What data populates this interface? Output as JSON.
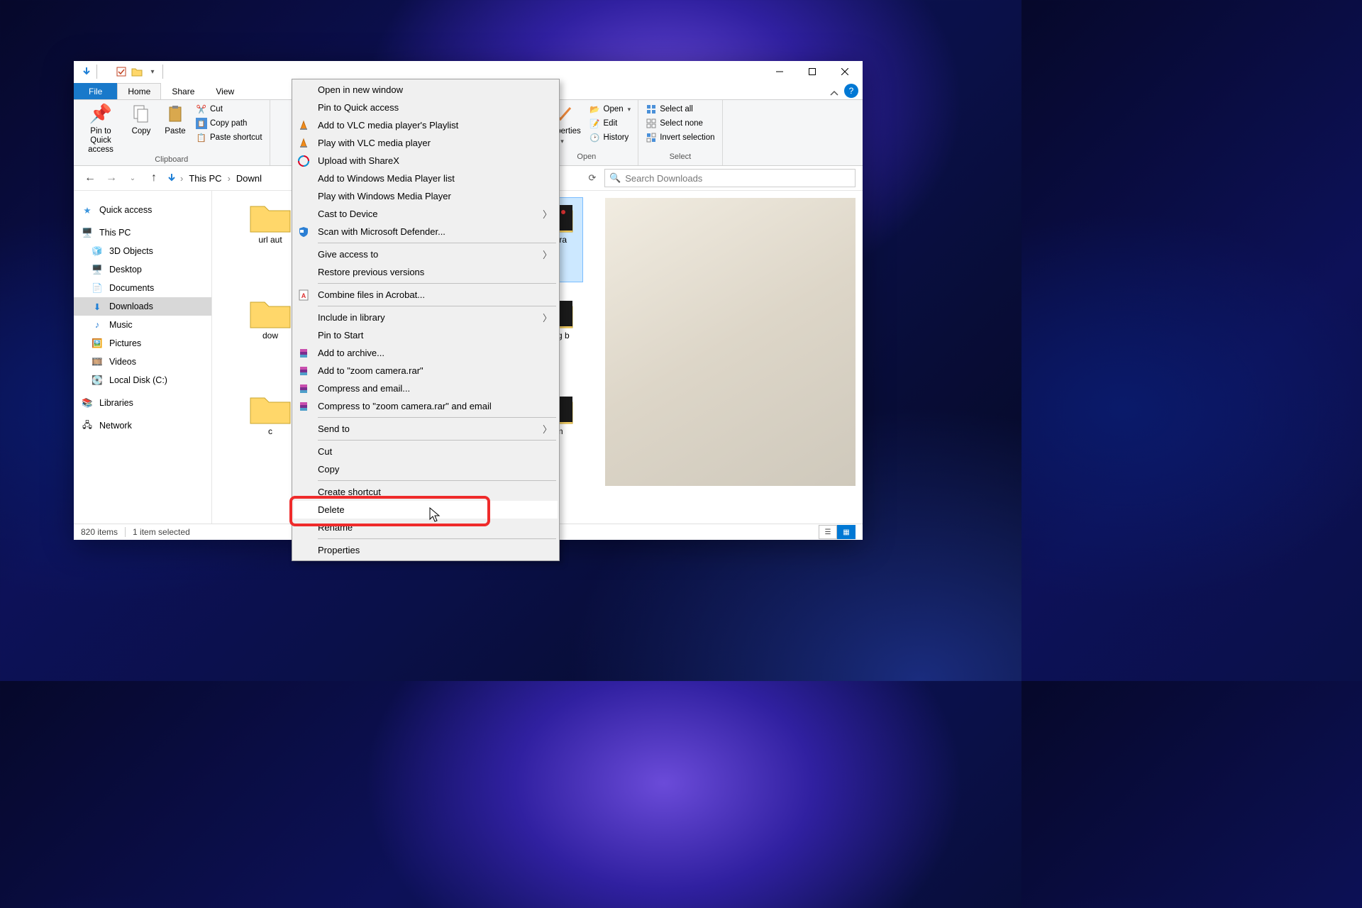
{
  "tabs": {
    "file": "File",
    "home": "Home",
    "share": "Share",
    "view": "View"
  },
  "ribbon": {
    "clipboard": {
      "pin": "Pin to Quick access",
      "copy": "Copy",
      "paste": "Paste",
      "cut": "Cut",
      "copypath": "Copy path",
      "pasteshort": "Paste shortcut",
      "label": "Clipboard"
    },
    "open": {
      "properties": "Properties",
      "open": "Open",
      "edit": "Edit",
      "history": "History",
      "label": "Open"
    },
    "select": {
      "all": "Select all",
      "none": "Select none",
      "invert": "Invert selection",
      "label": "Select"
    }
  },
  "breadcrumb": {
    "pc": "This PC",
    "dl": "Downl"
  },
  "search": {
    "placeholder": "Search Downloads"
  },
  "nav": {
    "quick": "Quick access",
    "pc": "This PC",
    "items": [
      "3D Objects",
      "Desktop",
      "Documents",
      "Downloads",
      "Music",
      "Pictures",
      "Videos",
      "Local Disk (C:)"
    ],
    "libs": "Libraries",
    "net": "Network"
  },
  "folders": {
    "f1": "url aut",
    "f2": "dow",
    "f3": "c",
    "f4": "camera",
    "f5": "closing b",
    "f6": "zoom"
  },
  "context": [
    {
      "label": "Open in new window"
    },
    {
      "label": "Pin to Quick access"
    },
    {
      "label": "Add to VLC media player's Playlist",
      "icon": "vlc"
    },
    {
      "label": "Play with VLC media player",
      "icon": "vlc"
    },
    {
      "label": "Upload with ShareX",
      "icon": "sharex"
    },
    {
      "label": "Add to Windows Media Player list"
    },
    {
      "label": "Play with Windows Media Player"
    },
    {
      "label": "Cast to Device",
      "arrow": true
    },
    {
      "label": "Scan with Microsoft Defender...",
      "icon": "defender"
    },
    {
      "sep": true
    },
    {
      "label": "Give access to",
      "arrow": true
    },
    {
      "label": "Restore previous versions"
    },
    {
      "sep": true
    },
    {
      "label": "Combine files in Acrobat...",
      "icon": "acrobat"
    },
    {
      "sep": true
    },
    {
      "label": "Include in library",
      "arrow": true
    },
    {
      "label": "Pin to Start"
    },
    {
      "label": "Add to archive...",
      "icon": "rar"
    },
    {
      "label": "Add to \"zoom camera.rar\"",
      "icon": "rar"
    },
    {
      "label": "Compress and email...",
      "icon": "rar"
    },
    {
      "label": "Compress to \"zoom camera.rar\" and email",
      "icon": "rar"
    },
    {
      "sep": true
    },
    {
      "label": "Send to",
      "arrow": true
    },
    {
      "sep": true
    },
    {
      "label": "Cut"
    },
    {
      "label": "Copy"
    },
    {
      "sep": true
    },
    {
      "label": "Create shortcut"
    },
    {
      "label": "Delete",
      "sel": true
    },
    {
      "label": "Rename"
    },
    {
      "sep": true
    },
    {
      "label": "Properties"
    }
  ],
  "status": {
    "count": "820 items",
    "sel": "1 item selected"
  }
}
